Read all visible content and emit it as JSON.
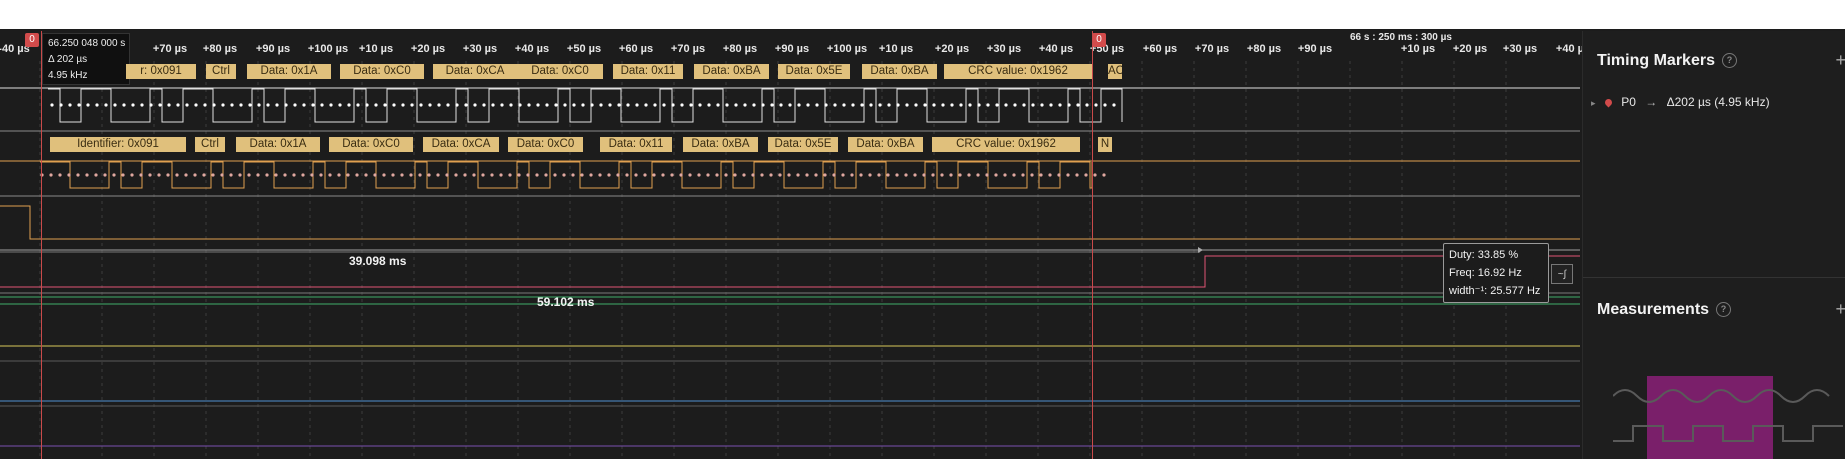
{
  "ruler": {
    "ticks": [
      "-40 µs",
      "+70 µs",
      "+80 µs",
      "+90 µs",
      "+100 µs",
      "+10 µs",
      "+20 µs",
      "+30 µs",
      "+40 µs",
      "+50 µs",
      "+60 µs",
      "+70 µs",
      "+80 µs",
      "+90 µs",
      "+100 µs",
      "+10 µs",
      "+20 µs",
      "+30 µs",
      "+40 µs",
      "+50 µs",
      "+60 µs",
      "+70 µs",
      "+80 µs",
      "+90 µs",
      "+10 µs",
      "+20 µs",
      "+30 µs",
      "+40 µs"
    ],
    "timestamp": "66 s : 250 ms : 300 µs",
    "marker_left": "0",
    "marker_right": "0"
  },
  "tooltip": {
    "time": "66.250 048 000 s",
    "delta": "Δ 202 µs",
    "freq": "4.95 kHz"
  },
  "decode_row1": [
    "r: 0x091",
    "Ctrl",
    "Data: 0x1A",
    "Data: 0xC0",
    "Data: 0xCA",
    "Data: 0xC0",
    "Data: 0x11",
    "Data: 0xBA",
    "Data: 0x5E",
    "Data: 0xBA",
    "CRC value: 0x1962",
    "AC"
  ],
  "decode_row2": [
    "Identifier: 0x091",
    "Ctrl",
    "Data: 0x1A",
    "Data: 0xC0",
    "Data: 0xCA",
    "Data: 0xC0",
    "Data: 0x11",
    "Data: 0xBA",
    "Data: 0x5E",
    "Data: 0xBA",
    "CRC value: 0x1962",
    "N"
  ],
  "measure_labels": {
    "a": "39.098 ms",
    "b": "59.102 ms"
  },
  "measurement_box": {
    "duty": "Duty: 33.85 %",
    "freq": "Freq: 16.92 Hz",
    "width": "width⁻¹: 25.577 Hz"
  },
  "panel": {
    "timing_title": "Timing Markers",
    "marker_row_name": "P0",
    "marker_row_value": "Δ202 µs (4.95 kHz)",
    "measurements_title": "Measurements",
    "help_glyph": "?",
    "add_glyph": "+",
    "expand_glyph": "▸",
    "arrow_glyph": "→"
  },
  "colors": {
    "decode_fill": "#e0c07c",
    "marker": "#d24b4b",
    "channel_white": "#e0e0e0",
    "channel_orange": "#e0a050",
    "channel_pink": "#e05575",
    "channel_green": "#3fae6a",
    "channel_yellow": "#d8c85a",
    "channel_blue": "#4f8fd0",
    "accent_purple": "#7a1f6a"
  },
  "icons": [
    "help-icon",
    "add-icon",
    "chevron-right-icon",
    "marker-pin-icon",
    "arrow-right-icon",
    "waveform-toggle-icon",
    "sine-wave-icon",
    "square-wave-icon"
  ]
}
